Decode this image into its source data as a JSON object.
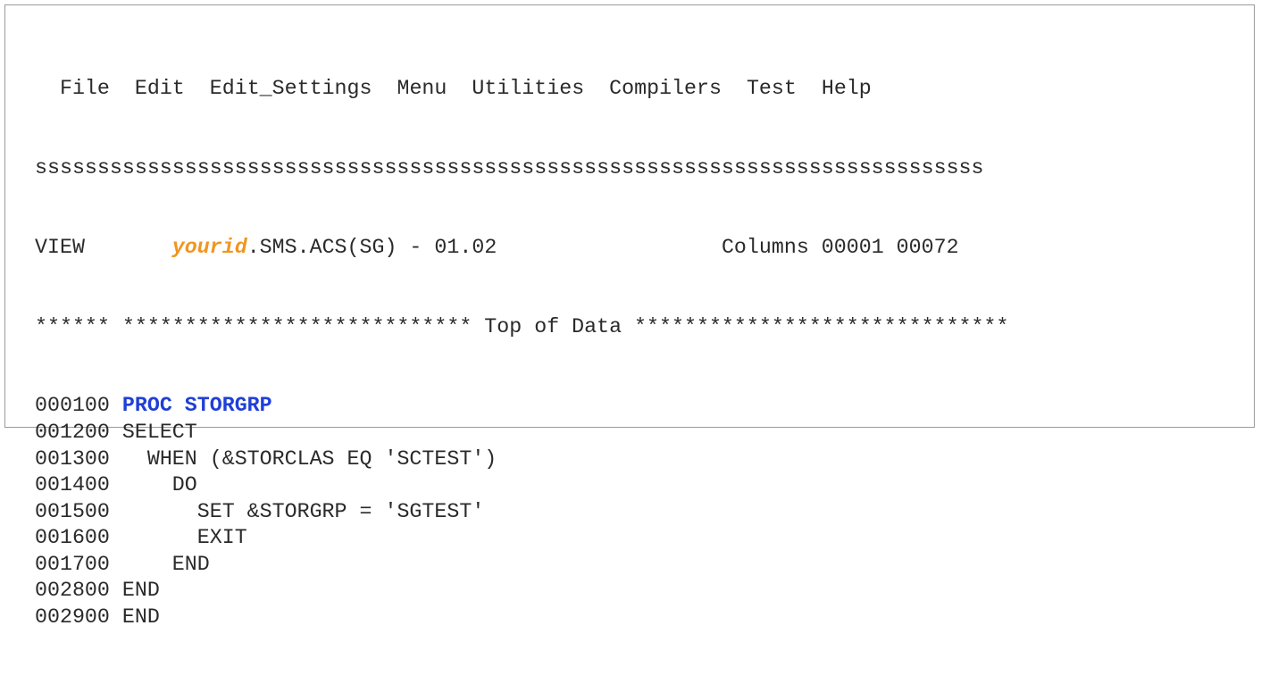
{
  "menu_bar": {
    "items": [
      "File",
      "Edit",
      "Edit_Settings",
      "Menu",
      "Utilities",
      "Compilers",
      "Test",
      "Help"
    ]
  },
  "separator": "ssssssssssssssssssssssssssssssssssssssssssssssssssssssssssssssssssssssssssss",
  "header": {
    "mode": "VIEW",
    "dataset_variable": "yourid",
    "dataset_rest": ".SMS.ACS(SG) - 01.02",
    "columns_label": "Columns 00001 00072"
  },
  "top_of_data": "****** **************************** Top of Data ******************************",
  "code_lines": [
    {
      "num": "000100",
      "text": "PROC STORGRP",
      "highlight": true
    },
    {
      "num": "001200",
      "text": "SELECT",
      "highlight": false
    },
    {
      "num": "001300",
      "text": "  WHEN (&STORCLAS EQ 'SCTEST')",
      "highlight": false
    },
    {
      "num": "001400",
      "text": "    DO",
      "highlight": false
    },
    {
      "num": "001500",
      "text": "      SET &STORGRP = 'SGTEST'",
      "highlight": false
    },
    {
      "num": "001600",
      "text": "      EXIT",
      "highlight": false
    },
    {
      "num": "001700",
      "text": "    END",
      "highlight": false
    },
    {
      "num": "002800",
      "text": "END",
      "highlight": false
    },
    {
      "num": "002900",
      "text": "END",
      "highlight": false
    }
  ],
  "colors": {
    "text": "#2a2a2a",
    "variable": "#f0961e",
    "keyword": "#1f3fd6",
    "border": "#9a9a9a"
  }
}
